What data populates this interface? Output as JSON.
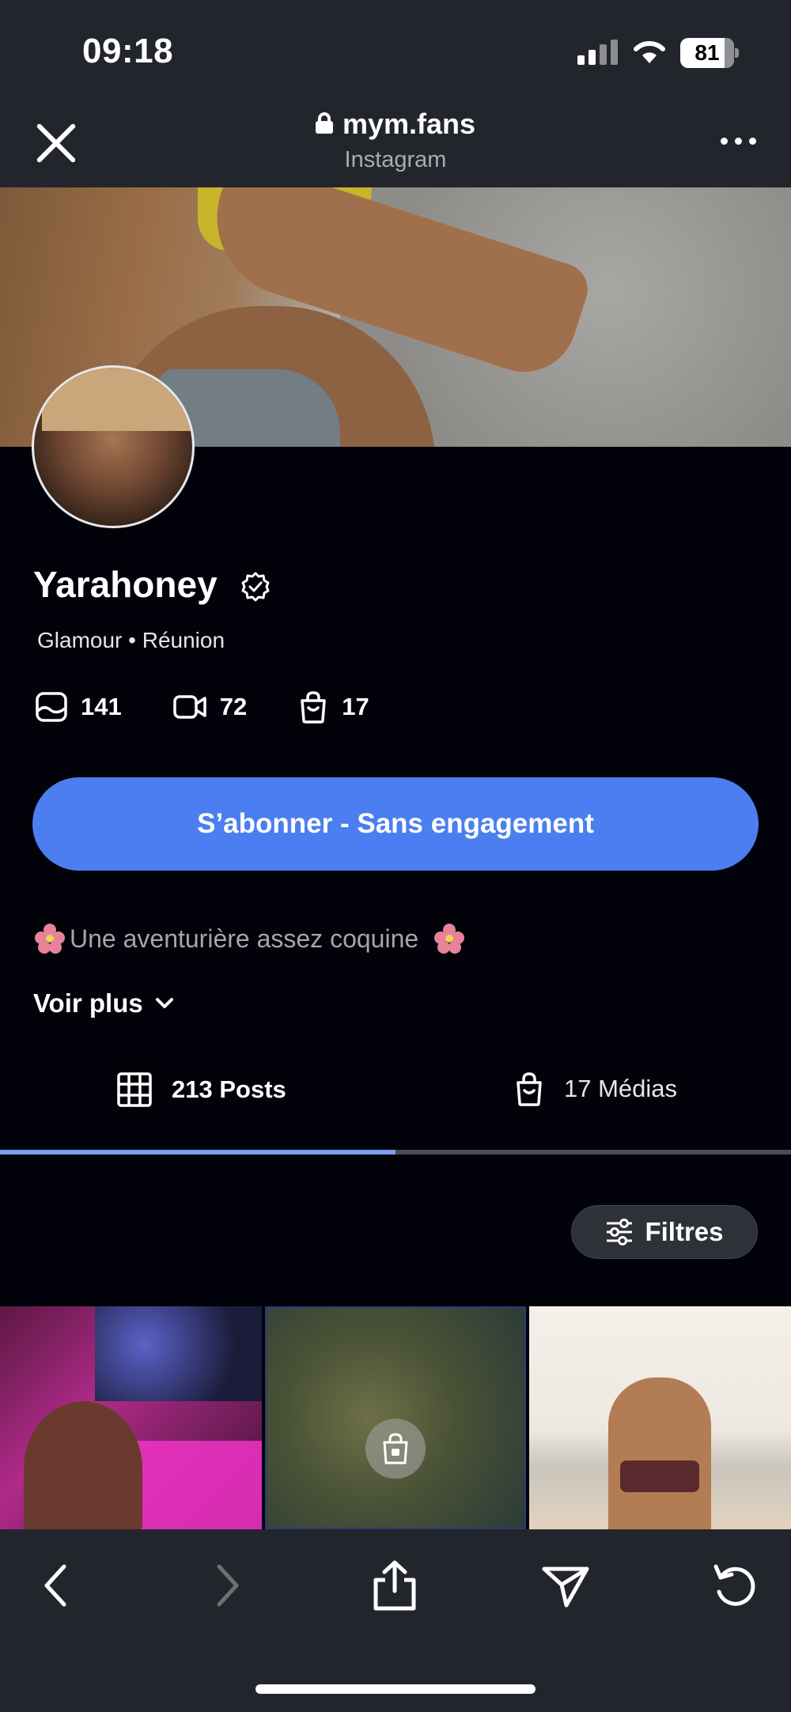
{
  "status_bar": {
    "time": "09:18",
    "battery": "81"
  },
  "browser": {
    "domain": "mym.fans",
    "source": "Instagram"
  },
  "profile": {
    "name": "Yarahoney",
    "tagline": "Glamour • Réunion",
    "stats": {
      "photos": "141",
      "videos": "72",
      "media": "17"
    },
    "subscribe_label": "S’abonner - Sans engagement",
    "bio": "Une aventurière assez coquine",
    "see_more": "Voir plus"
  },
  "tabs": [
    {
      "label": "213 Posts",
      "active": true
    },
    {
      "label": "17 Médias",
      "active": false
    }
  ],
  "filters_label": "Filtres",
  "colors": {
    "accent": "#4b7ef0",
    "background": "#02030a",
    "chrome": "#23252c",
    "tab_indicator": "#7c9ef0"
  },
  "icons": [
    "close-icon",
    "lock-icon",
    "more-icon",
    "verified-icon",
    "photo-icon",
    "video-icon",
    "bag-icon",
    "chevron-down-icon",
    "grid-icon",
    "filter-icon",
    "back-icon",
    "forward-icon",
    "share-icon",
    "send-icon",
    "reload-icon"
  ]
}
